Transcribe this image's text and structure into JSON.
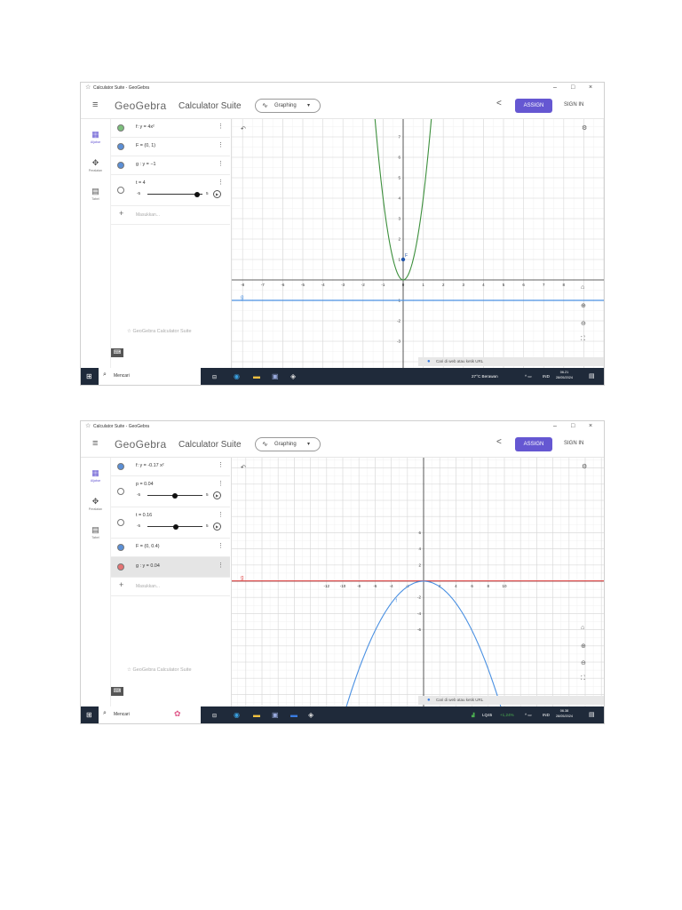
{
  "window_title": "Calculator Suite - GeoGebra",
  "window_controls": [
    "–",
    "□",
    "×"
  ],
  "app": {
    "menu_icon": "hamburger-icon",
    "logo": "GeoGebra",
    "suite": "Calculator Suite",
    "graphing_label": "Graphing",
    "share_icon": "share-icon",
    "assign_label": "ASSIGN",
    "signin_label": "SIGN IN",
    "accent_color": "#6557d2"
  },
  "rail": [
    {
      "label": "Aljabar",
      "icon": "calculator-icon"
    },
    {
      "label": "Peralatan",
      "icon": "tools-icon"
    },
    {
      "label": "Tabel",
      "icon": "table-icon"
    }
  ],
  "add_placeholder": "Masukkan...",
  "footer_logo": "GeoGebra Calculator Suite",
  "popup_text": "Cari di web atau ketik URL",
  "search_text": "Mencari",
  "screens": [
    {
      "items": [
        {
          "expr": "f: y = 4x²",
          "color": "#7cbf7c",
          "type": "dot"
        },
        {
          "expr": "F = (0, 1)",
          "color": "#5b8fd6",
          "type": "dot"
        },
        {
          "expr": "g : y = −1",
          "color": "#5b8fd6",
          "type": "dot"
        },
        {
          "expr": "t = 4",
          "type": "slider",
          "min": "-5",
          "max": "5",
          "value": 4
        }
      ],
      "graph": {
        "x_ticks": [
          "-8",
          "-7",
          "-6",
          "-5",
          "-4",
          "-3",
          "-2",
          "-1",
          "0",
          "1",
          "2",
          "3",
          "4",
          "5",
          "6",
          "7",
          "8"
        ],
        "y_ticks": [
          "7",
          "6",
          "5",
          "4",
          "3",
          "2",
          "1",
          "-1",
          "-2",
          "-3"
        ],
        "labels": {
          "line": "g",
          "point": "F"
        },
        "curve": {
          "a": 4,
          "color": "#3c8f3c"
        },
        "line": {
          "y": -1,
          "color": "#4a90e2"
        },
        "point": {
          "x": 0,
          "y": 1,
          "color": "#2255aa"
        }
      },
      "tray": {
        "weather": "27°C Berawan",
        "lang": "IND",
        "time": "06.21",
        "date": "28/05/2024"
      }
    },
    {
      "items": [
        {
          "expr": "f: y = -0.17 x²",
          "color": "#5b8fd6",
          "type": "dot"
        },
        {
          "expr": "p = 0.04",
          "type": "slider",
          "min": "-5",
          "max": "5",
          "value": 0.04
        },
        {
          "expr": "t = 0.16",
          "type": "slider",
          "min": "-5",
          "max": "5",
          "value": 0.16
        },
        {
          "expr": "F = (0, 0.4)",
          "color": "#5b8fd6",
          "type": "dot"
        },
        {
          "expr": "g : y = 0.04",
          "color": "#e57373",
          "type": "dot",
          "selected": true
        }
      ],
      "graph": {
        "x_ticks": [
          "-12",
          "-10",
          "-8",
          "-6",
          "-4",
          "-2",
          "2",
          "4",
          "6",
          "8",
          "10"
        ],
        "y_ticks": [
          "6",
          "4",
          "2",
          "-2",
          "-4",
          "-6"
        ],
        "labels": {
          "line": "g",
          "curve": "f"
        },
        "curve": {
          "a": -0.17,
          "color": "#4a90e2"
        },
        "line": {
          "y": 0.04,
          "color": "#e05555"
        }
      },
      "tray": {
        "stock": "LQ45",
        "stock_change": "+1,24%",
        "lang": "IND",
        "time": "06.38",
        "date": "28/05/2024"
      }
    }
  ]
}
